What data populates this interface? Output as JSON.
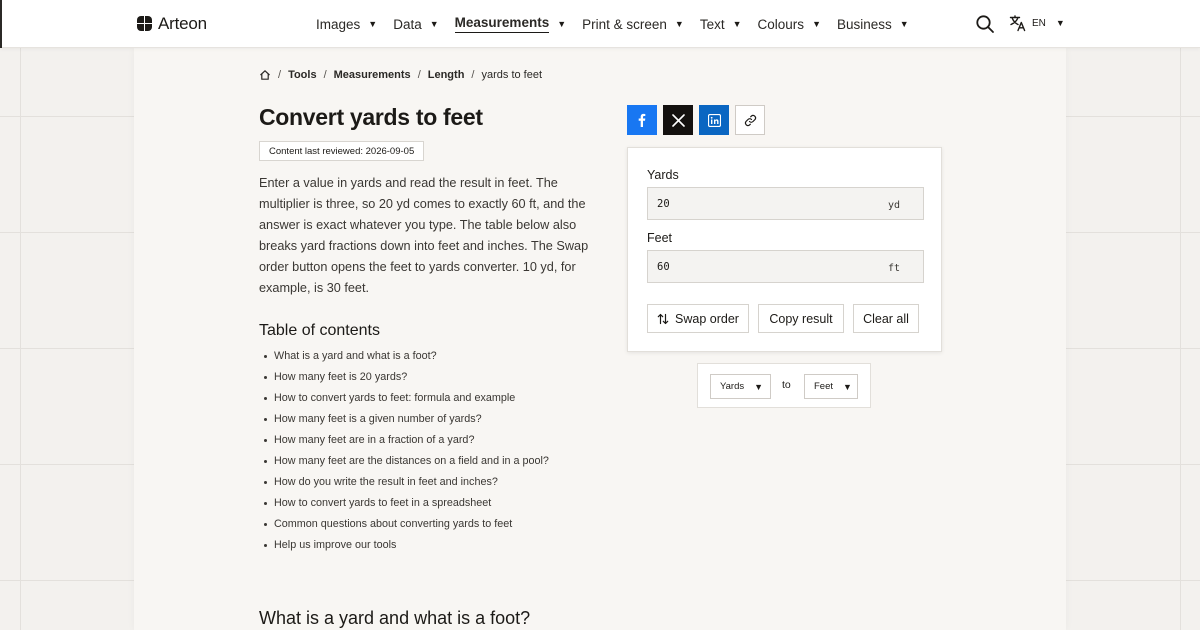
{
  "brand": {
    "name": "Arteon"
  },
  "nav": {
    "items": [
      {
        "label": "Images"
      },
      {
        "label": "Data"
      },
      {
        "label": "Measurements",
        "active": true
      },
      {
        "label": "Print & screen"
      },
      {
        "label": "Text"
      },
      {
        "label": "Colours"
      },
      {
        "label": "Business"
      }
    ],
    "language": "EN"
  },
  "breadcrumb": {
    "items": [
      "Tools",
      "Measurements",
      "Length"
    ],
    "current": "yards to feet"
  },
  "page": {
    "title": "Convert yards to feet",
    "reviewed": "Content last reviewed: 2026-09-05",
    "intro": "Enter a value in yards and read the result in feet. The multiplier is three, so 20 yd comes to exactly 60 ft, and the answer is exact whatever you type. The table below also breaks yard fractions down into feet and inches. The Swap order button opens the feet to yards converter. 10 yd, for example, is 30 feet."
  },
  "toc": {
    "title": "Table of contents",
    "items": [
      "What is a yard and what is a foot?",
      "How many feet is 20 yards?",
      "How to convert yards to feet: formula and example",
      "How many feet is a given number of yards?",
      "How many feet are in a fraction of a yard?",
      "How many feet are the distances on a field and in a pool?",
      "How do you write the result in feet and inches?",
      "How to convert yards to feet in a spreadsheet",
      "Common questions about converting yards to feet",
      "Help us improve our tools"
    ]
  },
  "section": {
    "title": "What is a yard and what is a foot?"
  },
  "converter": {
    "input": {
      "label": "Yards",
      "value": "20",
      "unit": "yd"
    },
    "output": {
      "label": "Feet",
      "value": "60",
      "unit": "ft"
    },
    "buttons": {
      "swap": "Swap order",
      "copy": "Copy result",
      "clear": "Clear all"
    }
  },
  "unit_picker": {
    "from": "Yards",
    "to_label": "to",
    "to": "Feet"
  },
  "icons": {
    "logo": "arteon-logo-icon",
    "search": "search-icon",
    "language": "translate-icon",
    "home": "home-icon",
    "facebook": "facebook-icon",
    "x": "x-icon",
    "linkedin": "linkedin-icon",
    "link": "link-icon",
    "swap": "swap-arrows-icon"
  },
  "colors": {
    "facebook": "#1877f2",
    "x": "#14110f",
    "linkedin": "#0a66c2",
    "panel": "#f8f6f3",
    "background": "#f3f1ee"
  }
}
